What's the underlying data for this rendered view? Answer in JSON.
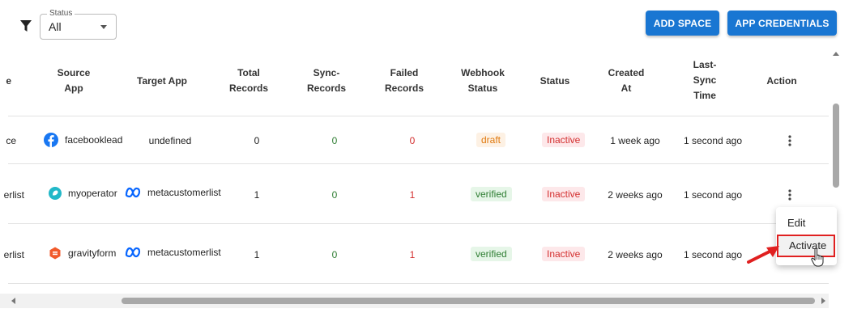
{
  "toolbar": {
    "filter_icon": "filter-funnel-icon",
    "status_label": "Status",
    "status_value": "All",
    "add_space": "ADD SPACE",
    "app_credentials": "APP CREDENTIALS"
  },
  "table": {
    "headers": {
      "partial": "e",
      "source_app_1": "Source",
      "source_app_2": "App",
      "target_app": "Target App",
      "total_1": "Total",
      "total_2": "Records",
      "sync_1": "Sync-",
      "sync_2": "Records",
      "failed_1": "Failed",
      "failed_2": "Records",
      "webhook_1": "Webhook",
      "webhook_2": "Status",
      "status": "Status",
      "created_1": "Created",
      "created_2": "At",
      "last_1": "Last-",
      "last_2": "Sync",
      "last_3": "Time",
      "action": "Action"
    },
    "rows": [
      {
        "partial": "ce",
        "source": "facebooklead",
        "source_icon": "facebook-icon",
        "target": "undefined",
        "total": "0",
        "sync": "0",
        "failed": "0",
        "webhook": "draft",
        "status": "Inactive",
        "created": "1 week ago",
        "last_sync": "1 second ago"
      },
      {
        "partial": "erlist",
        "source": "myoperator",
        "source_icon": "myoperator-icon",
        "target": "metacustomerlist",
        "target_icon": "meta-icon",
        "total": "1",
        "sync": "0",
        "failed": "1",
        "webhook": "verified",
        "status": "Inactive",
        "created": "2 weeks ago",
        "last_sync": "1 second ago"
      },
      {
        "partial": "erlist",
        "source": "gravityform",
        "source_icon": "gravityform-icon",
        "target": "metacustomerlist",
        "target_icon": "meta-icon",
        "total": "1",
        "sync": "0",
        "failed": "1",
        "webhook": "verified",
        "status": "Inactive",
        "created": "2 weeks ago",
        "last_sync": "1 second ago"
      }
    ]
  },
  "menu": {
    "edit": "Edit",
    "activate": "Activate"
  },
  "colors": {
    "primary": "#1976d2",
    "highlight": "#e02020"
  }
}
